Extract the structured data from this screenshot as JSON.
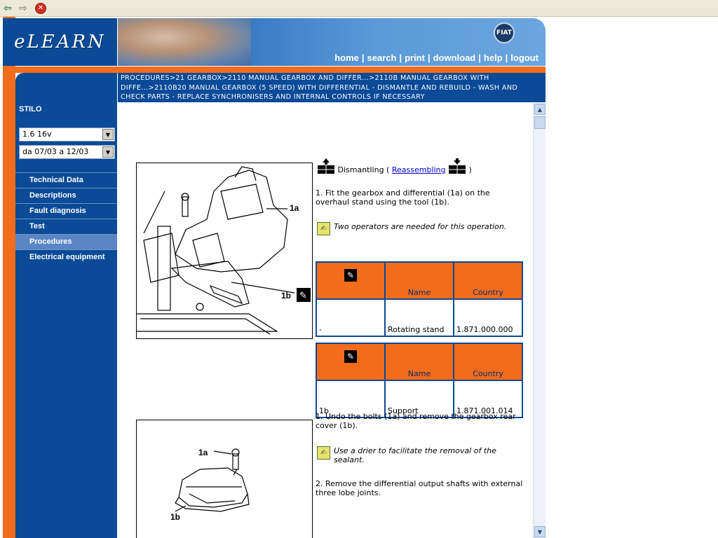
{
  "browser": {
    "back_icon": "arrow-left-icon",
    "forward_icon": "arrow-right-icon",
    "stop_icon": "stop-icon"
  },
  "logo": {
    "text": "eLEARN"
  },
  "header": {
    "brand_badge": "FIAT",
    "nav": [
      "home",
      "search",
      "print",
      "download",
      "help",
      "logout"
    ]
  },
  "breadcrumb": {
    "text": "PROCEDURES>21 GEARBOX>2110 MANUAL GEARBOX AND DIFFER...>2110B MANUAL GEARBOX WITH DIFFE...>2110B20 MANUAL GEARBOX (5 SPEED) WITH DIFFERENTIAL - DISMANTLE AND REBUILD - WASH AND CHECK PARTS - REPLACE SYNCHRONISERS AND INTERNAL CONTROLS IF NECESSARY"
  },
  "sidebar": {
    "model": "STILO",
    "engine_select": "1.6 16v",
    "date_select": "da 07/03 a 12/03",
    "menu": [
      {
        "label": "Technical Data",
        "active": false
      },
      {
        "label": "Descriptions",
        "active": false
      },
      {
        "label": "Fault diagnosis",
        "active": false
      },
      {
        "label": "Test",
        "active": false
      },
      {
        "label": "Procedures",
        "active": true
      },
      {
        "label": "Electrical equipment",
        "active": false
      }
    ]
  },
  "content": {
    "dismantling_label": "Dismantling (",
    "reassembling_link": "Reassembling",
    "close_paren": ")",
    "step1": "1. Fit the gearbox and differential (1a) on the overhaul stand using the tool (1b).",
    "note1": "Two operators are needed for this operation.",
    "tables": [
      {
        "headers": [
          "",
          "Name",
          "Country"
        ],
        "row": [
          "-",
          "Rotating stand",
          "1.871.000.000"
        ]
      },
      {
        "headers": [
          "",
          "Name",
          "Country"
        ],
        "row": [
          "1b",
          "Support",
          "1.871.001.014"
        ]
      }
    ],
    "step_undo": "1. Undo the bolts (1a) and remove the gearbox rear cover (1b).",
    "note2": "Use a drier to facilitate the removal of the sealant.",
    "step2": "2. Remove the differential output shafts with external three lobe joints.",
    "figure1_labels": {
      "a": "1a",
      "b": "1b"
    },
    "figure2_labels": {
      "a": "1a",
      "b": "1b"
    }
  },
  "colors": {
    "blue": "#0a4a97",
    "orange": "#f26c1c",
    "active_menu": "#5a86c6"
  }
}
